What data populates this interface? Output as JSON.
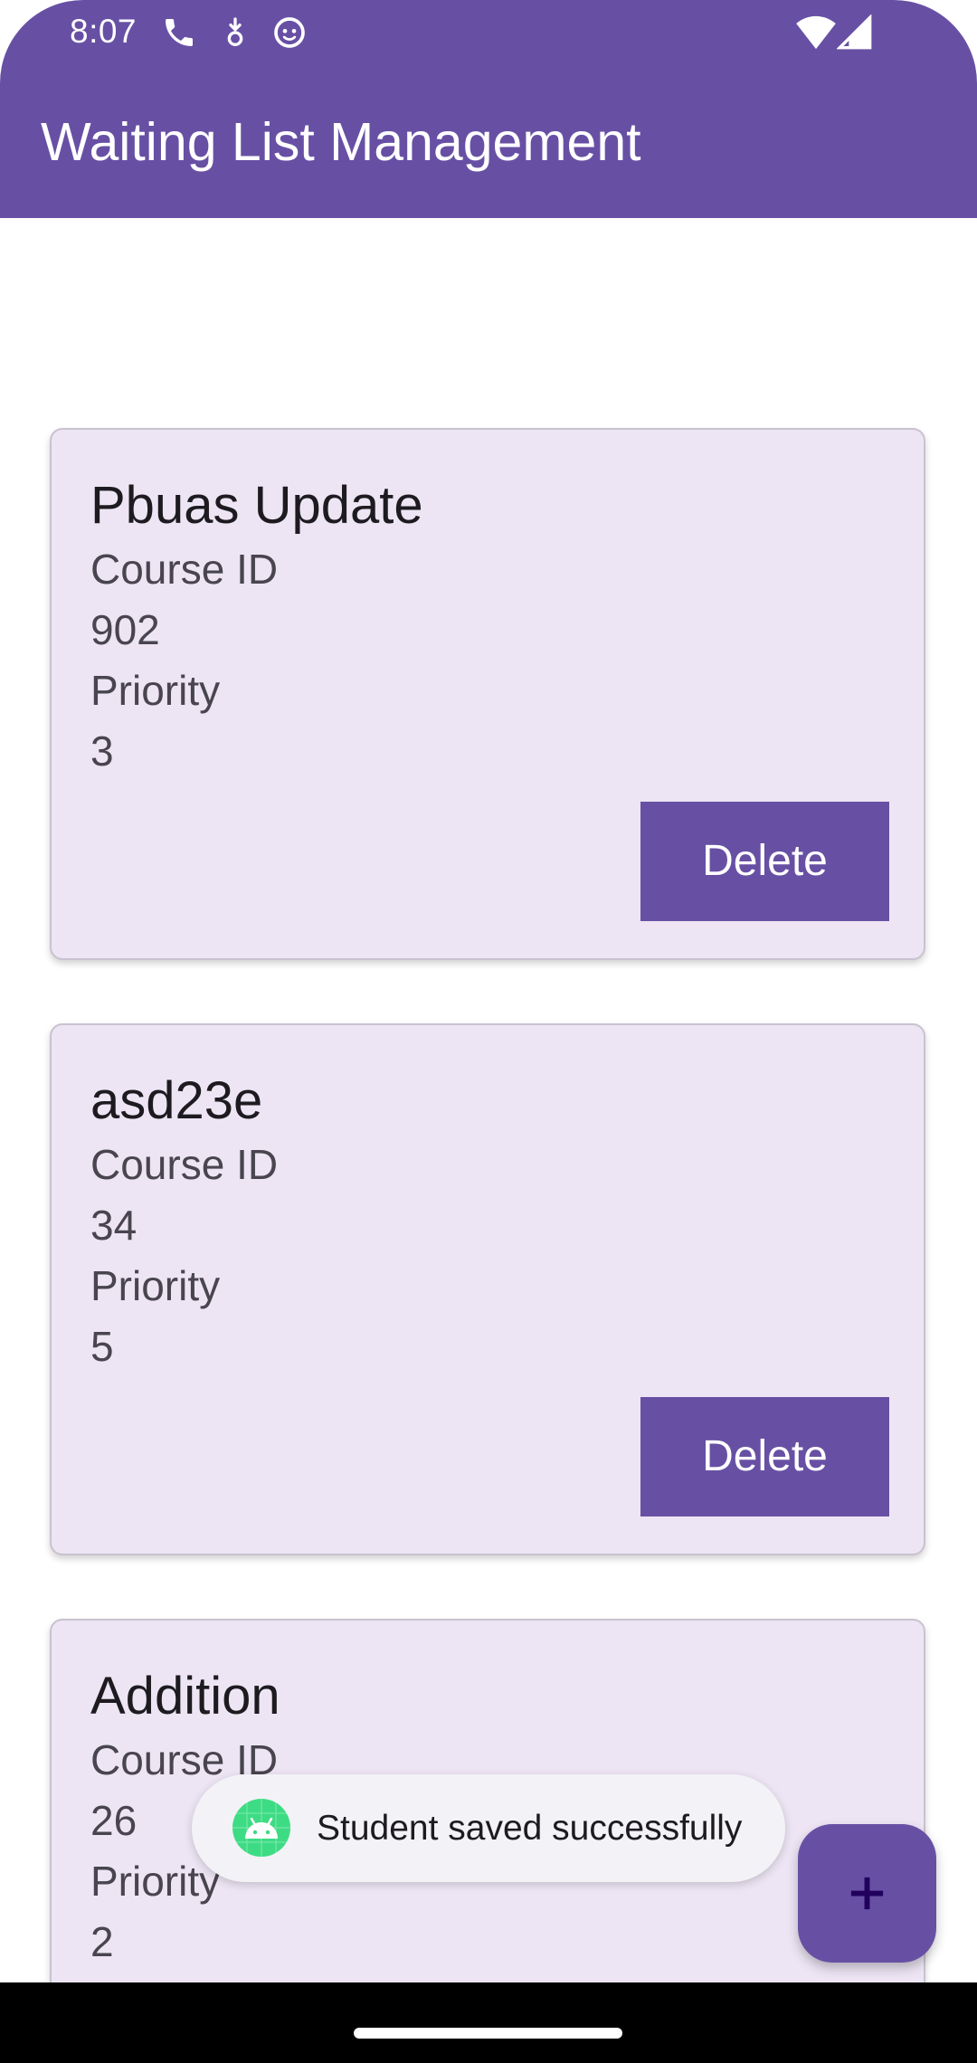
{
  "status_bar": {
    "time": "8:07",
    "icons": [
      "phone-icon",
      "download-badge-icon",
      "face-icon",
      "wifi-icon",
      "signal-icon"
    ]
  },
  "app_bar": {
    "title": "Waiting List Management",
    "color": "#6750A4"
  },
  "students": [
    {
      "name": "Pbuas Update",
      "course_label": "Course ID",
      "course_id": "902",
      "priority_label": "Priority",
      "priority": "3",
      "delete_label": "Delete"
    },
    {
      "name": "asd23e",
      "course_label": "Course ID",
      "course_id": "34",
      "priority_label": "Priority",
      "priority": "5",
      "delete_label": "Delete"
    },
    {
      "name": "Addition",
      "course_label": "Course ID",
      "course_id": "26",
      "priority_label": "Priority",
      "priority": "2"
    }
  ],
  "toast": {
    "message": "Student saved successfully",
    "icon": "android-icon"
  },
  "fab": {
    "icon": "plus-icon"
  },
  "colors": {
    "primary": "#6750A4",
    "card_background": "#EDE5F4",
    "toast_background": "#F3F2F7"
  }
}
